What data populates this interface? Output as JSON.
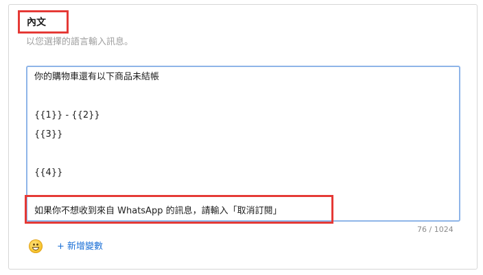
{
  "section": {
    "title": "內文",
    "subtitle": "以您選擇的語言輸入訊息。"
  },
  "editor": {
    "lines": [
      "你的購物車還有以下商品未結帳",
      "",
      "{{1}} - {{2}}",
      "{{3}}",
      "",
      "{{4}}",
      "",
      "如果你不想收到來自 WhatsApp 的訊息，請輸入「取消訂閱」"
    ],
    "char_count": "76 / 1024"
  },
  "toolbar": {
    "emoji_icon": "grinning-face-emoji-icon",
    "add_variable_label": "+ 新增變數"
  },
  "colors": {
    "highlight": "#e53935",
    "editor_border": "#8db4e8",
    "link": "#1a6fd6"
  }
}
